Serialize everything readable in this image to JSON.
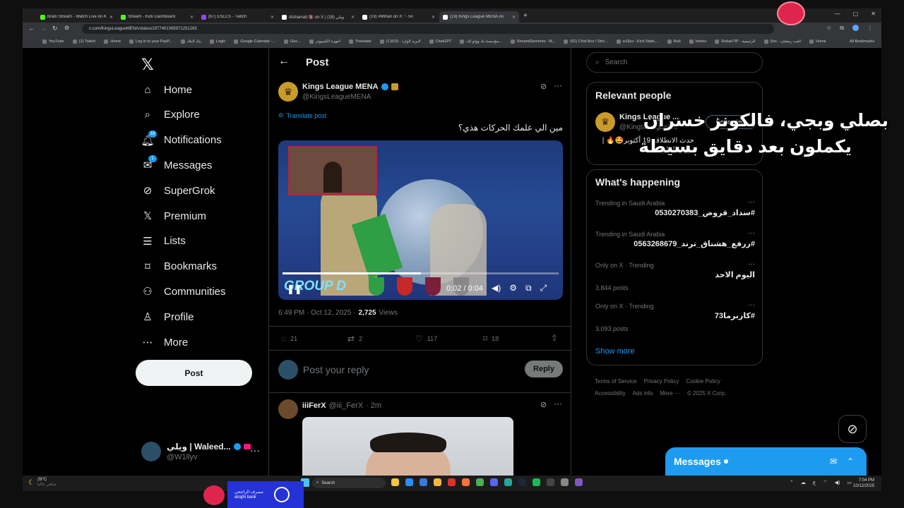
{
  "browser": {
    "tabs": [
      {
        "label": "Brain Stream - Watch Live on K",
        "color": "#53fc18"
      },
      {
        "label": "Stream - Kick Dashboard",
        "color": "#53fc18"
      },
      {
        "label": "(67) ESLCS - Twitch",
        "color": "#9146ff"
      },
      {
        "label": "Alshamali 🔞 on X | ويلي (18)",
        "color": "#ffffff"
      },
      {
        "label": "(19) #Mihan on X: \"- 5#",
        "color": "#ffffff"
      },
      {
        "label": "(19) Kings League MENA on",
        "color": "#ffffff"
      }
    ],
    "new_tab": "+",
    "url": "x.com/KingsLeagueMENA/status/1977401365971251265",
    "bookmarks": [
      "YouTube",
      "(1) Twitch",
      "Home",
      "Log in to your PayP...",
      "بنك البلاد",
      "Login",
      "Google Calendar -...",
      "Goo...",
      "أجهزة الكمبيوتر",
      "Translate",
      "(1,819) - البريد الوارد",
      "ChatGPT",
      "مؤسسة بك وولو للتـ...",
      "StreamElements - M...",
      "(52) Chat Box / Stre...",
      "w18yv - Kick Stats,...",
      "Kick",
      "botmo",
      "DokanTIP - الرئيسية",
      "Doc - العب رمضان",
      "Home - Restream"
    ],
    "all_bookmarks": "All Bookmarks"
  },
  "nav": {
    "items": [
      {
        "label": "Home",
        "icon": "home-icon"
      },
      {
        "label": "Explore",
        "icon": "search-icon"
      },
      {
        "label": "Notifications",
        "icon": "bell-icon",
        "badge": "18"
      },
      {
        "label": "Messages",
        "icon": "mail-icon",
        "badge": "1"
      },
      {
        "label": "SuperGrok",
        "icon": "grok-icon"
      },
      {
        "label": "Premium",
        "icon": "x-logo-icon"
      },
      {
        "label": "Lists",
        "icon": "list-icon"
      },
      {
        "label": "Bookmarks",
        "icon": "bookmark-icon"
      },
      {
        "label": "Communities",
        "icon": "people-icon"
      },
      {
        "label": "Profile",
        "icon": "person-icon"
      },
      {
        "label": "More",
        "icon": "more-circle-icon"
      }
    ],
    "post_label": "Post",
    "account": {
      "name": "ويلي | Waleed...",
      "handle": "@W1llyv"
    }
  },
  "main": {
    "header": "Post",
    "tweet": {
      "name": "Kings League MENA",
      "handle": "@KingsLeagueMENA",
      "translate": "Translate post",
      "text": "مين الي علمك الحركات هذي؟",
      "video_time": "0:02 / 0:04",
      "video_progress": 0.5,
      "timestamp": "6:49 PM · Oct 12, 2025 ·",
      "views": "2,725",
      "views_label": "Views",
      "replies": "21",
      "reposts": "2",
      "likes": "117",
      "bookmarks": "18"
    },
    "reply": {
      "placeholder": "Post your reply",
      "button": "Reply"
    },
    "next_tweet": {
      "name": "iiiFerX",
      "handle": "@iii_FerX",
      "time": "· 2m"
    }
  },
  "right": {
    "search_placeholder": "Search",
    "relevant_title": "Relevant people",
    "person": {
      "name": "Kings League ...",
      "handle": "@KingsLeagueMe",
      "follow": "Following",
      "bio": "حدث الانطلاقة 19 أكتوبر🤩🔥 | دوري الملوك"
    },
    "happening_title": "What's happening",
    "trends": [
      {
        "category": "Trending in Saudi Arabia",
        "title": "#سداد_قروض_0530270383",
        "posts": ""
      },
      {
        "category": "Trending in Saudi Arabia",
        "title": "#ررفع_هشتاق_ترند_0563268679",
        "posts": ""
      },
      {
        "category": "Only on X · Trending",
        "title": "اليوم الاحد",
        "posts": "3,844 posts"
      },
      {
        "category": "Only on X · Trending",
        "title": "#كاربرما73",
        "posts": "3,093 posts"
      }
    ],
    "show_more": "Show more",
    "footer": [
      "Terms of Service",
      "Privacy Policy",
      "Cookie Policy",
      "Accessibility",
      "Ads info",
      "More ···",
      "© 2025 X Corp."
    ]
  },
  "messages_dock": {
    "label": "Messages"
  },
  "overlay": {
    "line1": "بصلي وبجي، فالكونز خسران",
    "line2": "يكملون بعد دقايق بسيطة"
  },
  "taskbar": {
    "weather_temp": "29°C",
    "weather_desc": "صافي غالبا",
    "search": "Search",
    "time": "7:04 PM",
    "date": "10/12/2025",
    "lang": "ع"
  },
  "bank_banner": {
    "ar": "مصرف الراجحي",
    "en": "alrajhi bank"
  }
}
